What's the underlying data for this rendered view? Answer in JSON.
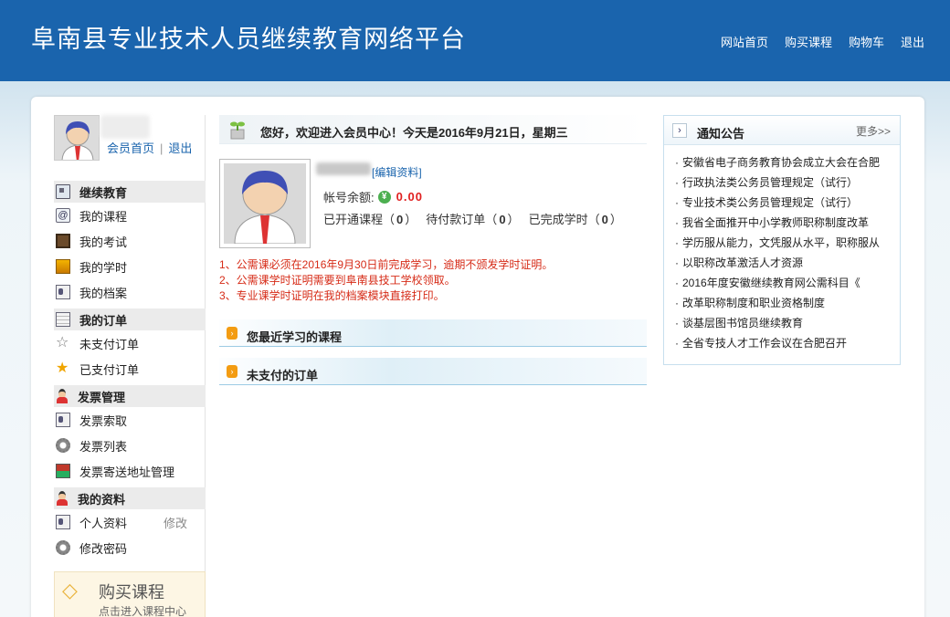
{
  "header": {
    "site_title": "阜南县专业技术人员继续教育网络平台",
    "nav": [
      "网站首页",
      "购买课程",
      "购物车",
      "退出"
    ]
  },
  "sidebar": {
    "member_home": "会员首页",
    "separator": "|",
    "logout": "退出",
    "groups": [
      {
        "title": "继续教育",
        "icon": "card-icon",
        "items": [
          {
            "label": "我的课程",
            "icon": "at-icon"
          },
          {
            "label": "我的考试",
            "icon": "board-icon"
          },
          {
            "label": "我的学时",
            "icon": "picture-icon"
          },
          {
            "label": "我的档案",
            "icon": "id-card-icon"
          }
        ]
      },
      {
        "title": "我的订单",
        "icon": "calendar-icon",
        "items": [
          {
            "label": "未支付订单",
            "icon": "star-outline-icon"
          },
          {
            "label": "已支付订单",
            "icon": "star-gold-icon"
          }
        ]
      },
      {
        "title": "发票管理",
        "icon": "person-icon",
        "items": [
          {
            "label": "发票索取",
            "icon": "id-card-icon"
          },
          {
            "label": "发票列表",
            "icon": "gear-icon"
          },
          {
            "label": "发票寄送地址管理",
            "icon": "box-icon"
          }
        ]
      },
      {
        "title": "我的资料",
        "icon": "person-icon",
        "items": [
          {
            "label": "个人资料",
            "icon": "id-card-icon",
            "extra": "修改"
          },
          {
            "label": "修改密码",
            "icon": "gear-icon"
          }
        ]
      }
    ],
    "buy_box": {
      "title": "购买课程",
      "subtitle": "点击进入课程中心"
    }
  },
  "main": {
    "welcome": "您好，欢迎进入会员中心！今天是2016年9月21日，星期三",
    "edit_profile": "[编辑资料]",
    "balance_label": "帐号余额:",
    "balance_value": "0.00",
    "stats": [
      {
        "label": "已开通课程",
        "value": "0"
      },
      {
        "label": "待付款订单",
        "value": "0"
      },
      {
        "label": "已完成学时",
        "value": "0"
      }
    ],
    "notices": [
      "1、公需课必须在2016年9月30日前完成学习，逾期不颁发学时证明。",
      "2、公需课学时证明需要到阜南县技工学校领取。",
      "3、专业课学时证明在我的档案模块直接打印。"
    ],
    "sections": [
      "您最近学习的课程",
      "未支付的订单"
    ]
  },
  "announcements": {
    "title": "通知公告",
    "more": "更多>>",
    "items": [
      "安徽省电子商务教育协会成立大会在合肥",
      "行政执法类公务员管理规定（试行）",
      "专业技术类公务员管理规定（试行）",
      "我省全面推开中小学教师职称制度改革",
      "学历服从能力，文凭服从水平，职称服从",
      "以职称改革激活人才资源",
      "2016年度安徽继续教育网公需科目《",
      "改革职称制度和职业资格制度",
      "谈基层图书馆员继续教育",
      "全省专技人才工作会议在合肥召开"
    ]
  }
}
